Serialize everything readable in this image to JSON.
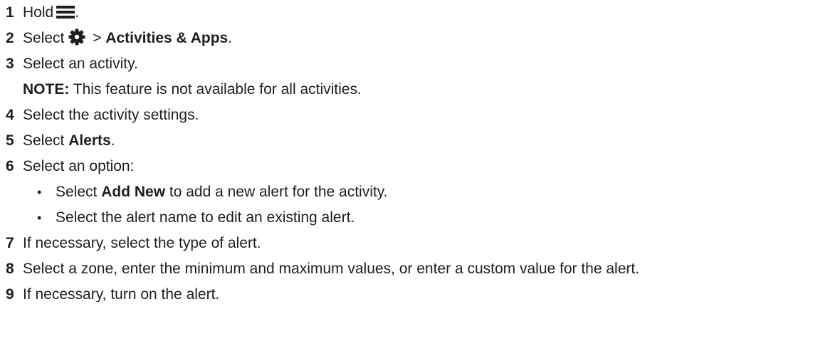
{
  "steps": [
    {
      "num": "1",
      "pre": "Hold",
      "icon": "menu-icon",
      "post": "."
    },
    {
      "num": "2",
      "pre": "Select",
      "icon": "gear-icon",
      "mid": " > ",
      "bold": "Activities & Apps",
      "post": "."
    },
    {
      "num": "3",
      "text": "Select an activity."
    },
    {
      "note_label": "NOTE:",
      "note_text": " This feature is not available for all activities."
    },
    {
      "num": "4",
      "text": "Select the activity settings."
    },
    {
      "num": "5",
      "pre": "Select ",
      "bold": "Alerts",
      "post": "."
    },
    {
      "num": "6",
      "text": "Select an option:"
    },
    {
      "bullet": "•",
      "pre": "Select ",
      "bold": "Add New",
      "post": " to add a new alert for the activity."
    },
    {
      "bullet": "•",
      "text": "Select the alert name to edit an existing alert."
    },
    {
      "num": "7",
      "text": "If necessary, select the type of alert."
    },
    {
      "num": "8",
      "text": "Select a zone, enter the minimum and maximum values, or enter a custom value for the alert."
    },
    {
      "num": "9",
      "text": "If necessary, turn on the alert."
    }
  ]
}
